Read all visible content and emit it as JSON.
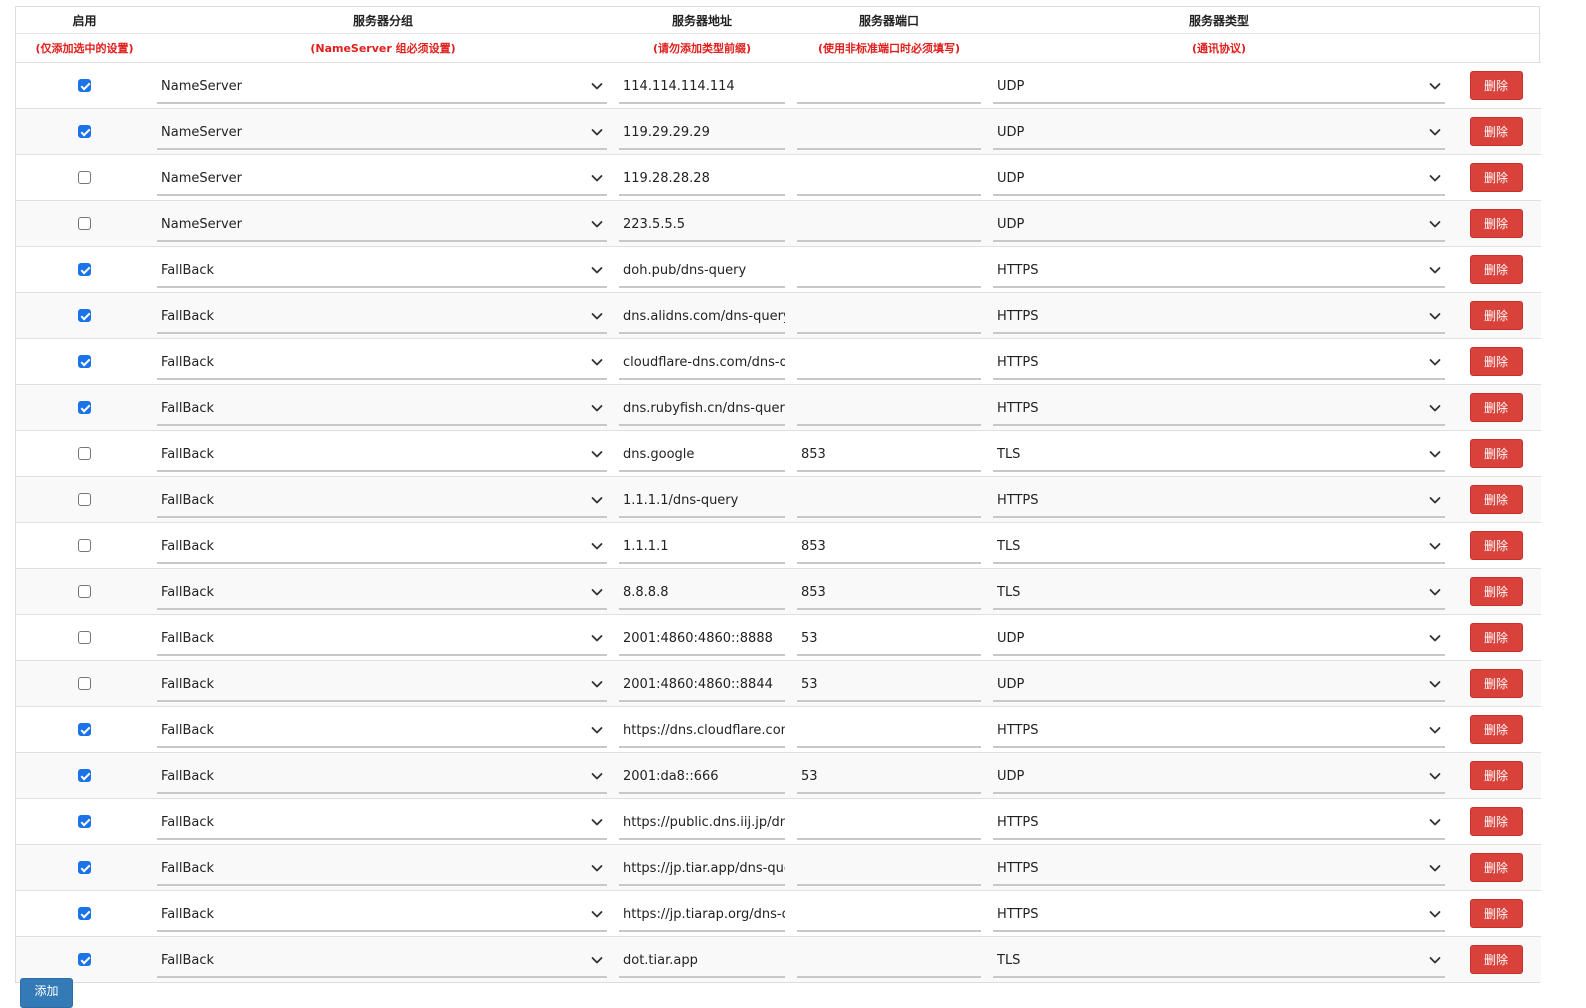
{
  "headers": {
    "enable": "启用",
    "group": "服务器分组",
    "address": "服务器地址",
    "port": "服务器端口",
    "type": "服务器类型"
  },
  "hints": {
    "enable": "(仅添加选中的设置)",
    "group": "(NameServer 组必须设置)",
    "address": "(请勿添加类型前缀)",
    "port": "(使用非标准端口时必须填写)",
    "type": "(通讯协议)"
  },
  "icons": {
    "select_arrow": "chevron-down-icon",
    "checkbox": "checkbox-icon"
  },
  "colors": {
    "hint_red": "#e0201d",
    "delete_red": "#d9413b",
    "add_blue": "#337ab7",
    "checkbox_blue": "#1a73e8"
  },
  "rows": [
    {
      "enabled": true,
      "group": "NameServer",
      "address": "114.114.114.114",
      "port": "",
      "type": "UDP",
      "delete_label": "删除"
    },
    {
      "enabled": true,
      "group": "NameServer",
      "address": "119.29.29.29",
      "port": "",
      "type": "UDP",
      "delete_label": "删除"
    },
    {
      "enabled": false,
      "group": "NameServer",
      "address": "119.28.28.28",
      "port": "",
      "type": "UDP",
      "delete_label": "删除"
    },
    {
      "enabled": false,
      "group": "NameServer",
      "address": "223.5.5.5",
      "port": "",
      "type": "UDP",
      "delete_label": "删除"
    },
    {
      "enabled": true,
      "group": "FallBack",
      "address": "doh.pub/dns-query",
      "port": "",
      "type": "HTTPS",
      "delete_label": "删除"
    },
    {
      "enabled": true,
      "group": "FallBack",
      "address": "dns.alidns.com/dns-query",
      "port": "",
      "type": "HTTPS",
      "delete_label": "删除"
    },
    {
      "enabled": true,
      "group": "FallBack",
      "address": "cloudflare-dns.com/dns-query",
      "port": "",
      "type": "HTTPS",
      "delete_label": "删除"
    },
    {
      "enabled": true,
      "group": "FallBack",
      "address": "dns.rubyfish.cn/dns-query",
      "port": "",
      "type": "HTTPS",
      "delete_label": "删除"
    },
    {
      "enabled": false,
      "group": "FallBack",
      "address": "dns.google",
      "port": "853",
      "type": "TLS",
      "delete_label": "删除"
    },
    {
      "enabled": false,
      "group": "FallBack",
      "address": "1.1.1.1/dns-query",
      "port": "",
      "type": "HTTPS",
      "delete_label": "删除"
    },
    {
      "enabled": false,
      "group": "FallBack",
      "address": "1.1.1.1",
      "port": "853",
      "type": "TLS",
      "delete_label": "删除"
    },
    {
      "enabled": false,
      "group": "FallBack",
      "address": "8.8.8.8",
      "port": "853",
      "type": "TLS",
      "delete_label": "删除"
    },
    {
      "enabled": false,
      "group": "FallBack",
      "address": "2001:4860:4860::8888",
      "port": "53",
      "type": "UDP",
      "delete_label": "删除"
    },
    {
      "enabled": false,
      "group": "FallBack",
      "address": "2001:4860:4860::8844",
      "port": "53",
      "type": "UDP",
      "delete_label": "删除"
    },
    {
      "enabled": true,
      "group": "FallBack",
      "address": "https://dns.cloudflare.com/dns-query",
      "port": "",
      "type": "HTTPS",
      "delete_label": "删除"
    },
    {
      "enabled": true,
      "group": "FallBack",
      "address": "2001:da8::666",
      "port": "53",
      "type": "UDP",
      "delete_label": "删除"
    },
    {
      "enabled": true,
      "group": "FallBack",
      "address": "https://public.dns.iij.jp/dns-query",
      "port": "",
      "type": "HTTPS",
      "delete_label": "删除"
    },
    {
      "enabled": true,
      "group": "FallBack",
      "address": "https://jp.tiar.app/dns-query",
      "port": "",
      "type": "HTTPS",
      "delete_label": "删除"
    },
    {
      "enabled": true,
      "group": "FallBack",
      "address": "https://jp.tiarap.org/dns-query",
      "port": "",
      "type": "HTTPS",
      "delete_label": "删除"
    },
    {
      "enabled": true,
      "group": "FallBack",
      "address": "dot.tiar.app",
      "port": "",
      "type": "TLS",
      "delete_label": "删除"
    }
  ],
  "add_label": "添加"
}
